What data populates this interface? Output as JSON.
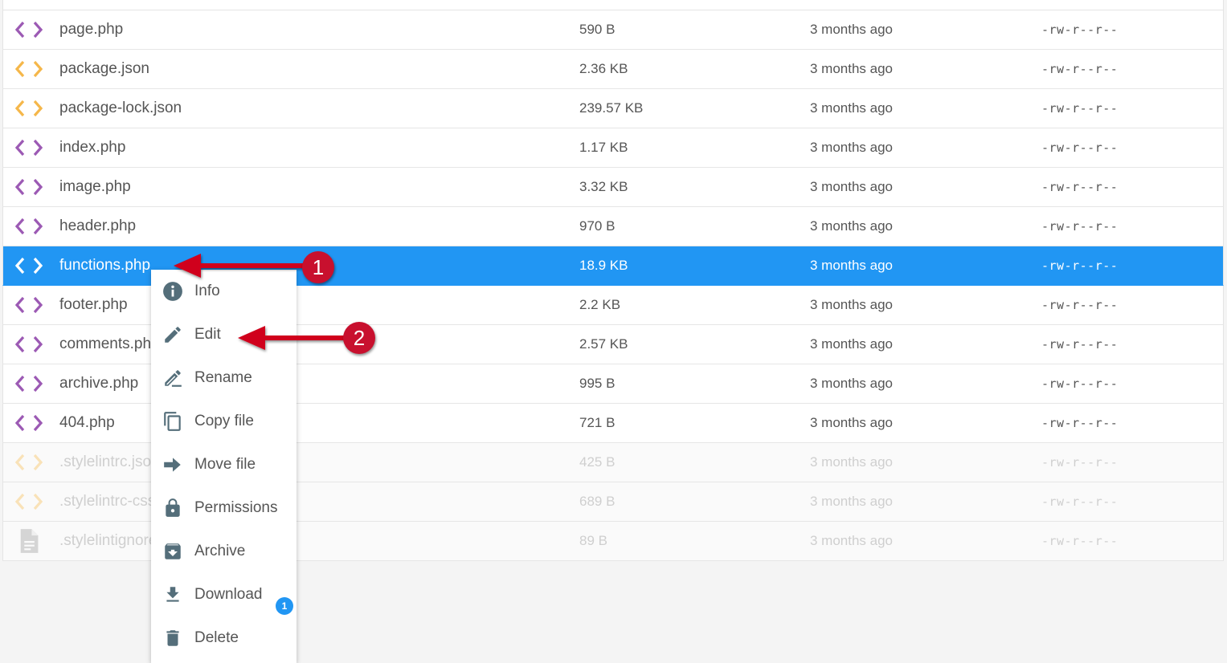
{
  "files": [
    {
      "name": "page.php",
      "size": "590 B",
      "modified": "3 months ago",
      "perms": "-rw-r--r--",
      "icon": "code-icon",
      "icon_color": "#9c5ab4",
      "state": "normal"
    },
    {
      "name": "package.json",
      "size": "2.36 KB",
      "modified": "3 months ago",
      "perms": "-rw-r--r--",
      "icon": "code-icon",
      "icon_color": "#f5b74a",
      "state": "normal"
    },
    {
      "name": "package-lock.json",
      "size": "239.57 KB",
      "modified": "3 months ago",
      "perms": "-rw-r--r--",
      "icon": "code-icon",
      "icon_color": "#f5b74a",
      "state": "normal"
    },
    {
      "name": "index.php",
      "size": "1.17 KB",
      "modified": "3 months ago",
      "perms": "-rw-r--r--",
      "icon": "code-icon",
      "icon_color": "#9c5ab4",
      "state": "normal"
    },
    {
      "name": "image.php",
      "size": "3.32 KB",
      "modified": "3 months ago",
      "perms": "-rw-r--r--",
      "icon": "code-icon",
      "icon_color": "#9c5ab4",
      "state": "normal"
    },
    {
      "name": "header.php",
      "size": "970 B",
      "modified": "3 months ago",
      "perms": "-rw-r--r--",
      "icon": "code-icon",
      "icon_color": "#9c5ab4",
      "state": "normal"
    },
    {
      "name": "functions.php",
      "size": "18.9 KB",
      "modified": "3 months ago",
      "perms": "-rw-r--r--",
      "icon": "code-icon",
      "icon_color": "#ffffff",
      "state": "selected"
    },
    {
      "name": "footer.php",
      "size": "2.2 KB",
      "modified": "3 months ago",
      "perms": "-rw-r--r--",
      "icon": "code-icon",
      "icon_color": "#9c5ab4",
      "state": "normal"
    },
    {
      "name": "comments.php",
      "size": "2.57 KB",
      "modified": "3 months ago",
      "perms": "-rw-r--r--",
      "icon": "code-icon",
      "icon_color": "#9c5ab4",
      "state": "normal"
    },
    {
      "name": "archive.php",
      "size": "995 B",
      "modified": "3 months ago",
      "perms": "-rw-r--r--",
      "icon": "code-icon",
      "icon_color": "#9c5ab4",
      "state": "normal"
    },
    {
      "name": "404.php",
      "size": "721 B",
      "modified": "3 months ago",
      "perms": "-rw-r--r--",
      "icon": "code-icon",
      "icon_color": "#9c5ab4",
      "state": "normal"
    },
    {
      "name": ".stylelintrc.json",
      "size": "425 B",
      "modified": "3 months ago",
      "perms": "-rw-r--r--",
      "icon": "code-icon",
      "icon_color": "#f9e2b8",
      "state": "hidden"
    },
    {
      "name": ".stylelintrc-css.json",
      "size": "689 B",
      "modified": "3 months ago",
      "perms": "-rw-r--r--",
      "icon": "code-icon",
      "icon_color": "#f9e2b8",
      "state": "hidden"
    },
    {
      "name": ".stylelintignore",
      "size": "89 B",
      "modified": "3 months ago",
      "perms": "-rw-r--r--",
      "icon": "document-icon",
      "icon_color": "#d5d5d5",
      "state": "hidden"
    }
  ],
  "context_menu": {
    "items": [
      {
        "label": "Info",
        "icon": "info-icon"
      },
      {
        "label": "Edit",
        "icon": "pencil-icon"
      },
      {
        "label": "Rename",
        "icon": "rename-icon"
      },
      {
        "label": "Copy file",
        "icon": "copy-icon"
      },
      {
        "label": "Move file",
        "icon": "arrow-right-icon"
      },
      {
        "label": "Permissions",
        "icon": "lock-icon"
      },
      {
        "label": "Archive",
        "icon": "archive-icon"
      },
      {
        "label": "Download",
        "icon": "download-icon"
      },
      {
        "label": "Delete",
        "icon": "trash-icon"
      }
    ],
    "icon_color": "#546e7a"
  },
  "download_badge": "1",
  "annotations": [
    {
      "label": "1",
      "color": "#c8102e"
    },
    {
      "label": "2",
      "color": "#c8102e"
    }
  ]
}
